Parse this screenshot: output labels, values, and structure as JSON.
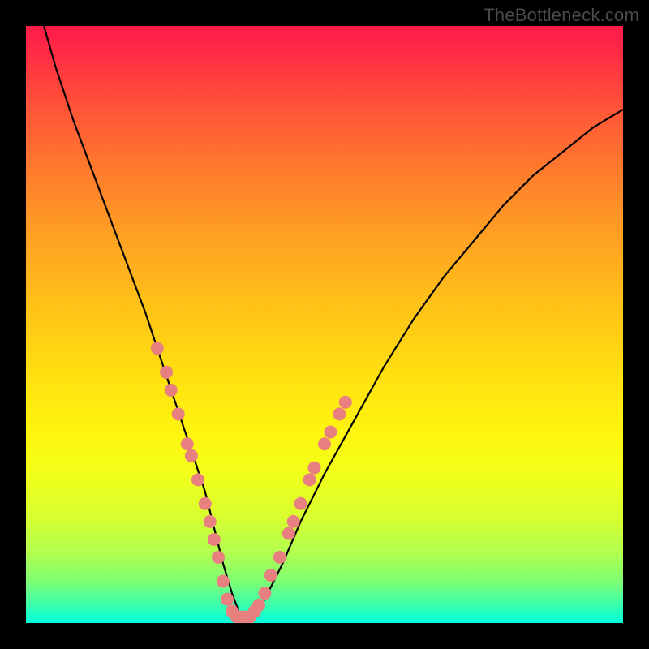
{
  "watermark": "TheBottleneck.com",
  "chart_data": {
    "type": "line",
    "title": "",
    "xlabel": "",
    "ylabel": "",
    "xlim": [
      0,
      100
    ],
    "ylim": [
      0,
      100
    ],
    "series": [
      {
        "name": "curve",
        "x": [
          3,
          5,
          8,
          11,
          14,
          17,
          20,
          22,
          24,
          26,
          28,
          30,
          31.5,
          33,
          34.5,
          36,
          38,
          40,
          43,
          46,
          50,
          55,
          60,
          65,
          70,
          75,
          80,
          85,
          90,
          95,
          100
        ],
        "y": [
          100,
          93,
          84,
          76,
          68,
          60,
          52,
          46,
          40,
          34,
          28,
          22,
          16,
          10,
          5,
          1,
          1,
          4,
          10,
          17,
          25,
          34,
          43,
          51,
          58,
          64,
          70,
          75,
          79,
          83,
          86
        ]
      }
    ],
    "markers": {
      "name": "highlight-dots",
      "color": "#e98080",
      "points": [
        {
          "x": 22.0,
          "y": 46
        },
        {
          "x": 23.5,
          "y": 42
        },
        {
          "x": 24.3,
          "y": 39
        },
        {
          "x": 25.5,
          "y": 35
        },
        {
          "x": 27.0,
          "y": 30
        },
        {
          "x": 27.7,
          "y": 28
        },
        {
          "x": 28.8,
          "y": 24
        },
        {
          "x": 30.0,
          "y": 20
        },
        {
          "x": 30.8,
          "y": 17
        },
        {
          "x": 31.5,
          "y": 14
        },
        {
          "x": 32.2,
          "y": 11
        },
        {
          "x": 33.0,
          "y": 7
        },
        {
          "x": 33.7,
          "y": 4
        },
        {
          "x": 34.5,
          "y": 2
        },
        {
          "x": 35.3,
          "y": 1
        },
        {
          "x": 36.0,
          "y": 1
        },
        {
          "x": 36.8,
          "y": 1
        },
        {
          "x": 37.5,
          "y": 1
        },
        {
          "x": 38.3,
          "y": 2
        },
        {
          "x": 39.0,
          "y": 3
        },
        {
          "x": 40.0,
          "y": 5
        },
        {
          "x": 41.0,
          "y": 8
        },
        {
          "x": 42.5,
          "y": 11
        },
        {
          "x": 44.0,
          "y": 15
        },
        {
          "x": 44.8,
          "y": 17
        },
        {
          "x": 46.0,
          "y": 20
        },
        {
          "x": 47.5,
          "y": 24
        },
        {
          "x": 48.3,
          "y": 26
        },
        {
          "x": 50.0,
          "y": 30
        },
        {
          "x": 51.0,
          "y": 32
        },
        {
          "x": 52.5,
          "y": 35
        },
        {
          "x": 53.5,
          "y": 37
        }
      ]
    }
  }
}
